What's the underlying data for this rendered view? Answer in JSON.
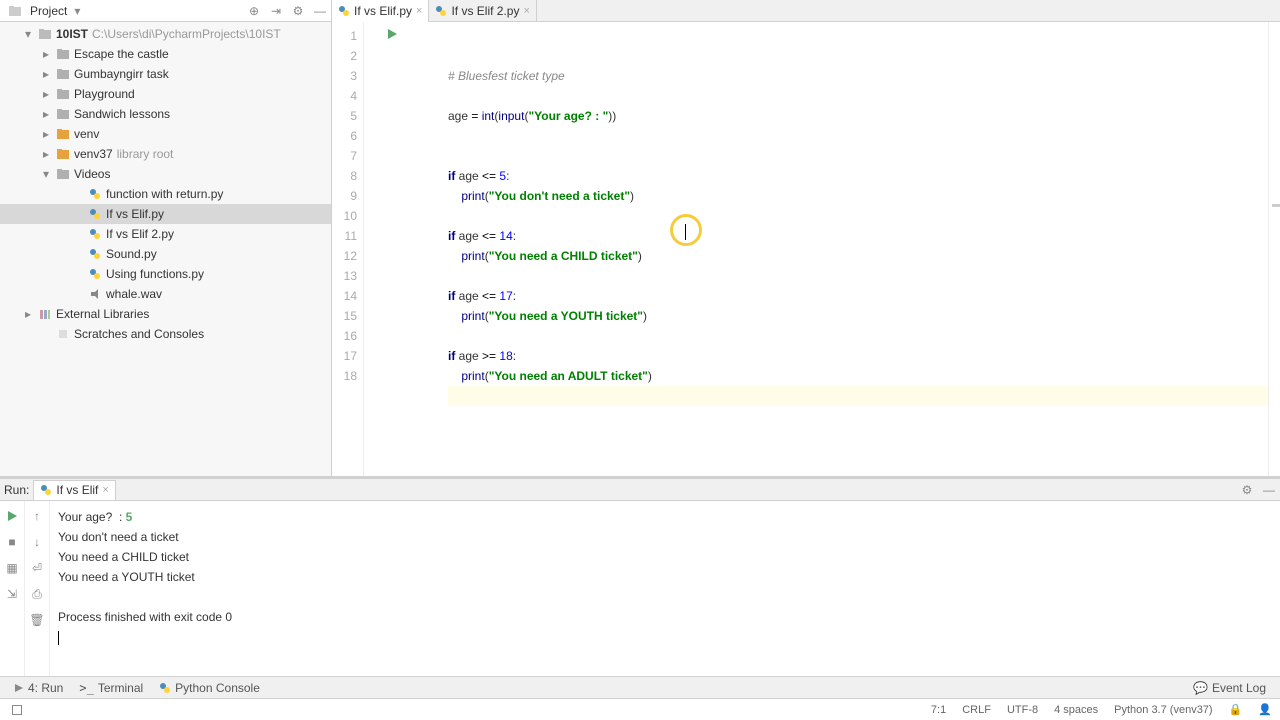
{
  "sidebar": {
    "title": "Project",
    "root": {
      "name": "10IST",
      "path": "C:\\Users\\di\\PycharmProjects\\10IST"
    },
    "items": [
      {
        "indent": 40,
        "chev": "right",
        "icon": "folder",
        "label": "Escape the castle"
      },
      {
        "indent": 40,
        "chev": "right",
        "icon": "folder",
        "label": "Gumbayngirr task"
      },
      {
        "indent": 40,
        "chev": "right",
        "icon": "folder",
        "label": "Playground"
      },
      {
        "indent": 40,
        "chev": "right",
        "icon": "folder",
        "label": "Sandwich lessons"
      },
      {
        "indent": 40,
        "chev": "right",
        "icon": "folder-orange",
        "label": "venv"
      },
      {
        "indent": 40,
        "chev": "right",
        "icon": "folder-orange",
        "label": "venv37",
        "sub": "library root"
      },
      {
        "indent": 40,
        "chev": "down",
        "icon": "folder",
        "label": "Videos"
      },
      {
        "indent": 72,
        "chev": "",
        "icon": "py",
        "label": "function with return.py"
      },
      {
        "indent": 72,
        "chev": "",
        "icon": "py",
        "label": "If vs Elif.py",
        "selected": true
      },
      {
        "indent": 72,
        "chev": "",
        "icon": "py",
        "label": "If vs Elif 2.py"
      },
      {
        "indent": 72,
        "chev": "",
        "icon": "py",
        "label": "Sound.py"
      },
      {
        "indent": 72,
        "chev": "",
        "icon": "py",
        "label": "Using functions.py"
      },
      {
        "indent": 72,
        "chev": "",
        "icon": "wav",
        "label": "whale.wav"
      },
      {
        "indent": 22,
        "chev": "right",
        "icon": "lib",
        "label": "External Libraries"
      },
      {
        "indent": 40,
        "chev": "",
        "icon": "scratch",
        "label": "Scratches and Consoles"
      }
    ]
  },
  "tabs": [
    {
      "label": "If vs Elif.py",
      "active": true
    },
    {
      "label": "If vs Elif 2.py",
      "active": false
    }
  ],
  "code_lines": [
    {
      "n": 1,
      "tokens": [
        {
          "t": "# Bluesfest ticket type",
          "c": "c-comment"
        }
      ]
    },
    {
      "n": 2,
      "tokens": []
    },
    {
      "n": 3,
      "tokens": [
        {
          "t": "age ",
          "c": ""
        },
        {
          "t": "=",
          "c": "c-op"
        },
        {
          "t": " ",
          "c": ""
        },
        {
          "t": "int",
          "c": "c-builtin"
        },
        {
          "t": "(",
          "c": ""
        },
        {
          "t": "input",
          "c": "c-builtin"
        },
        {
          "t": "(",
          "c": ""
        },
        {
          "t": "\"Your age? : \"",
          "c": "c-str"
        },
        {
          "t": "))",
          "c": ""
        }
      ]
    },
    {
      "n": 4,
      "tokens": []
    },
    {
      "n": 5,
      "tokens": []
    },
    {
      "n": 6,
      "tokens": [
        {
          "t": "if ",
          "c": "c-kw"
        },
        {
          "t": "age ",
          "c": ""
        },
        {
          "t": "<= ",
          "c": "c-op"
        },
        {
          "t": "5",
          "c": "c-num"
        },
        {
          "t": ":",
          "c": ""
        }
      ]
    },
    {
      "n": 7,
      "tokens": [
        {
          "t": "    ",
          "c": ""
        },
        {
          "t": "print",
          "c": "c-builtin"
        },
        {
          "t": "(",
          "c": ""
        },
        {
          "t": "\"You don't need a ticket\"",
          "c": "c-str"
        },
        {
          "t": ")",
          "c": ""
        }
      ]
    },
    {
      "n": 8,
      "tokens": []
    },
    {
      "n": 9,
      "tokens": [
        {
          "t": "if ",
          "c": "c-kw"
        },
        {
          "t": "age ",
          "c": ""
        },
        {
          "t": "<= ",
          "c": "c-op"
        },
        {
          "t": "14",
          "c": "c-num"
        },
        {
          "t": ":",
          "c": ""
        }
      ]
    },
    {
      "n": 10,
      "tokens": [
        {
          "t": "    ",
          "c": ""
        },
        {
          "t": "print",
          "c": "c-builtin"
        },
        {
          "t": "(",
          "c": ""
        },
        {
          "t": "\"You need a CHILD ticket\"",
          "c": "c-str"
        },
        {
          "t": ")",
          "c": ""
        }
      ]
    },
    {
      "n": 11,
      "tokens": []
    },
    {
      "n": 12,
      "tokens": [
        {
          "t": "if ",
          "c": "c-kw"
        },
        {
          "t": "age ",
          "c": ""
        },
        {
          "t": "<= ",
          "c": "c-op"
        },
        {
          "t": "17",
          "c": "c-num"
        },
        {
          "t": ":",
          "c": ""
        }
      ]
    },
    {
      "n": 13,
      "tokens": [
        {
          "t": "    ",
          "c": ""
        },
        {
          "t": "print",
          "c": "c-builtin"
        },
        {
          "t": "(",
          "c": ""
        },
        {
          "t": "\"You need a YOUTH ticket\"",
          "c": "c-str"
        },
        {
          "t": ")",
          "c": ""
        }
      ]
    },
    {
      "n": 14,
      "tokens": []
    },
    {
      "n": 15,
      "tokens": [
        {
          "t": "if ",
          "c": "c-kw"
        },
        {
          "t": "age ",
          "c": ""
        },
        {
          "t": ">= ",
          "c": "c-op"
        },
        {
          "t": "18",
          "c": "c-num"
        },
        {
          "t": ":",
          "c": ""
        }
      ]
    },
    {
      "n": 16,
      "tokens": [
        {
          "t": "    ",
          "c": ""
        },
        {
          "t": "print",
          "c": "c-builtin"
        },
        {
          "t": "(",
          "c": ""
        },
        {
          "t": "\"You need an ADULT ticket\"",
          "c": "c-str"
        },
        {
          "t": ")",
          "c": ""
        }
      ]
    },
    {
      "n": 17,
      "tokens": [],
      "highlight": true
    },
    {
      "n": 18,
      "tokens": []
    }
  ],
  "run": {
    "title": "Run:",
    "tab": "If vs Elif",
    "output": [
      "Your age? : 5",
      "You don't need a ticket",
      "You need a CHILD ticket",
      "You need a YOUTH ticket",
      "",
      "Process finished with exit code 0"
    ],
    "out_input": "5"
  },
  "bottom": {
    "run": "4: Run",
    "terminal": "Terminal",
    "pyconsole": "Python Console",
    "eventlog": "Event Log"
  },
  "status": {
    "pos": "7:1",
    "crlf": "CRLF",
    "enc": "UTF-8",
    "indent": "4 spaces",
    "interp": "Python 3.7 (venv37)"
  }
}
